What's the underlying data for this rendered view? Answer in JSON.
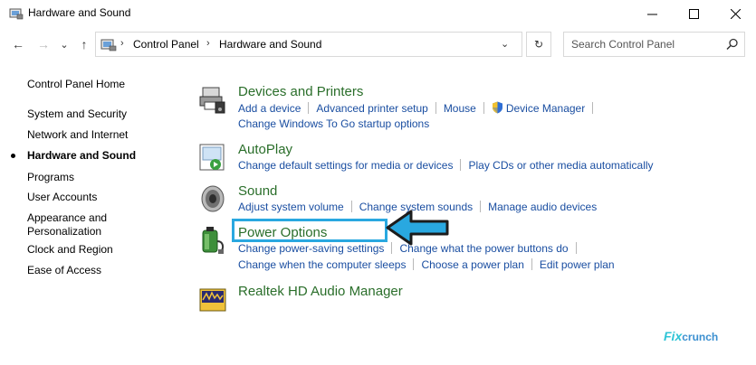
{
  "window": {
    "title": "Hardware and Sound",
    "minimize": "—",
    "maximize": "☐",
    "close": "✕"
  },
  "nav": {
    "back": "←",
    "forward": "→",
    "recent": "⌄",
    "up": "↑"
  },
  "address": {
    "crumbs": [
      "Control Panel",
      "Hardware and Sound"
    ],
    "separator": "›",
    "dropdown": "⌄",
    "refresh": "↻"
  },
  "search": {
    "placeholder": "Search Control Panel"
  },
  "sidebar": {
    "items": [
      {
        "label": "Control Panel Home"
      },
      {
        "label": "System and Security"
      },
      {
        "label": "Network and Internet"
      },
      {
        "label": "Hardware and Sound",
        "active": true
      },
      {
        "label": "Programs"
      },
      {
        "label": "User Accounts"
      },
      {
        "label": "Appearance and"
      },
      {
        "label": "Personalization"
      },
      {
        "label": "Clock and Region"
      },
      {
        "label": "Ease of Access"
      }
    ]
  },
  "categories": [
    {
      "title": "Devices and Printers",
      "icon": "printer-icon",
      "rows": [
        [
          "Add a device",
          "Advanced printer setup",
          "Mouse",
          "Device Manager"
        ],
        [
          "Change Windows To Go startup options"
        ]
      ]
    },
    {
      "title": "AutoPlay",
      "icon": "autoplay-icon",
      "rows": [
        [
          "Change default settings for media or devices",
          "Play CDs or other media automatically"
        ]
      ]
    },
    {
      "title": "Sound",
      "icon": "speaker-icon",
      "rows": [
        [
          "Adjust system volume",
          "Change system sounds",
          "Manage audio devices"
        ]
      ]
    },
    {
      "title": "Power Options",
      "icon": "battery-icon",
      "rows": [
        [
          "Change power-saving settings",
          "Change what the power buttons do"
        ],
        [
          "Change when the computer sleeps",
          "Choose a power plan",
          "Edit power plan"
        ]
      ]
    },
    {
      "title": "Realtek HD Audio Manager",
      "icon": "realtek-audio-icon",
      "rows": []
    }
  ],
  "colors": {
    "category_title": "#2a6e2a",
    "link": "#1a4ea1",
    "highlight": "#29a8e0"
  },
  "watermark": {
    "brand": "Fix",
    "rest": "crunch"
  }
}
